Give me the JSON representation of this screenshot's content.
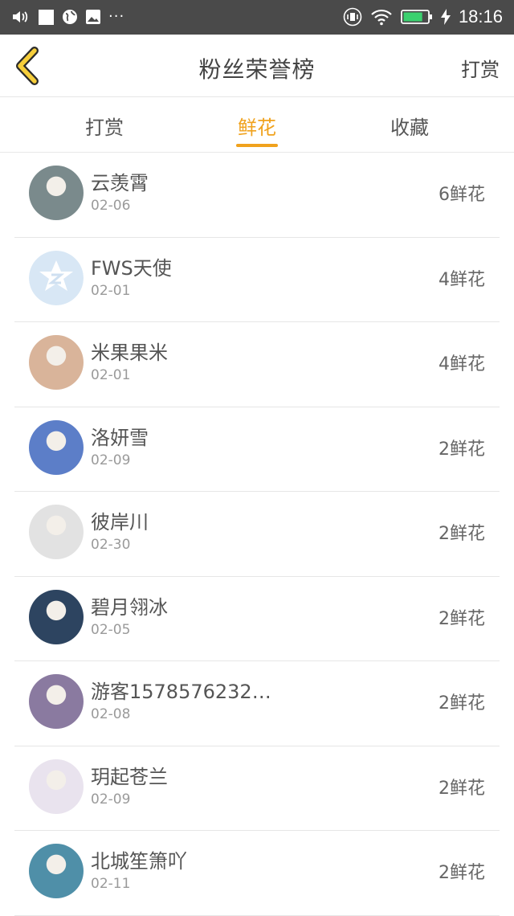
{
  "status_bar": {
    "time": "18:16",
    "left_icons": [
      "volume-icon",
      "square-icon",
      "globe-icon",
      "image-icon",
      "more-icon"
    ],
    "right_icons": [
      "vibrate-icon",
      "wifi-icon",
      "battery-icon",
      "charging-icon"
    ],
    "battery_percent": 80
  },
  "header": {
    "title": "粉丝荣誉榜",
    "action_label": "打赏",
    "accent": "#f0a21d"
  },
  "tabs": [
    {
      "label": "打赏",
      "active": false
    },
    {
      "label": "鲜花",
      "active": true
    },
    {
      "label": "收藏",
      "active": false
    }
  ],
  "rows": [
    {
      "name": "云羡霄",
      "date": "02-06",
      "count": "6鲜花",
      "avatar_color": "#7a8a8c"
    },
    {
      "name": "FWS天使",
      "date": "02-01",
      "count": "4鲜花",
      "avatar_color": "#cfe0f1"
    },
    {
      "name": "米果果米",
      "date": "02-01",
      "count": "4鲜花",
      "avatar_color": "#d9b49a"
    },
    {
      "name": "洛妍雪",
      "date": "02-09",
      "count": "2鲜花",
      "avatar_color": "#5c7ec8"
    },
    {
      "name": "彼岸川",
      "date": "02-30",
      "count": "2鲜花",
      "avatar_color": "#e2e2e2"
    },
    {
      "name": "碧月翎冰",
      "date": "02-05",
      "count": "2鲜花",
      "avatar_color": "#2d4460"
    },
    {
      "name": "游客1578576232…",
      "date": "02-08",
      "count": "2鲜花",
      "avatar_color": "#8a7aa0"
    },
    {
      "name": "玥起苍兰",
      "date": "02-09",
      "count": "2鲜花",
      "avatar_color": "#e9e3ee"
    },
    {
      "name": "北城笙箫吖",
      "date": "02-11",
      "count": "2鲜花",
      "avatar_color": "#4f8fa8"
    }
  ]
}
